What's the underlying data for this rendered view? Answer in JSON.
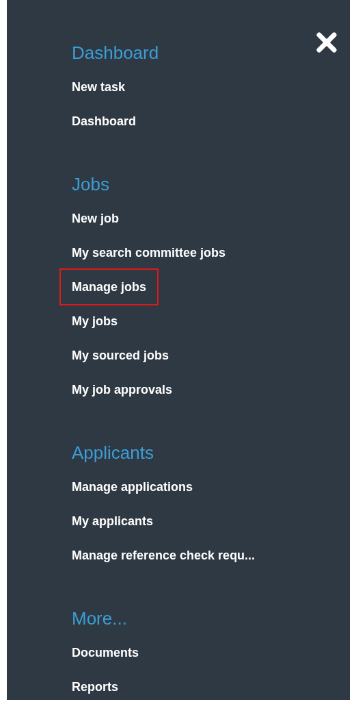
{
  "sections": [
    {
      "heading": "Dashboard",
      "items": [
        {
          "label": "New task",
          "highlighted": false
        },
        {
          "label": "Dashboard",
          "highlighted": false
        }
      ]
    },
    {
      "heading": "Jobs",
      "items": [
        {
          "label": "New job",
          "highlighted": false
        },
        {
          "label": "My search committee jobs",
          "highlighted": false
        },
        {
          "label": "Manage jobs",
          "highlighted": true
        },
        {
          "label": "My jobs",
          "highlighted": false
        },
        {
          "label": "My sourced jobs",
          "highlighted": false
        },
        {
          "label": "My job approvals",
          "highlighted": false
        }
      ]
    },
    {
      "heading": "Applicants",
      "items": [
        {
          "label": "Manage applications",
          "highlighted": false
        },
        {
          "label": "My applicants",
          "highlighted": false
        },
        {
          "label": "Manage reference check requ...",
          "highlighted": false
        }
      ]
    },
    {
      "heading": "More...",
      "items": [
        {
          "label": "Documents",
          "highlighted": false
        },
        {
          "label": "Reports",
          "highlighted": false
        }
      ]
    }
  ]
}
